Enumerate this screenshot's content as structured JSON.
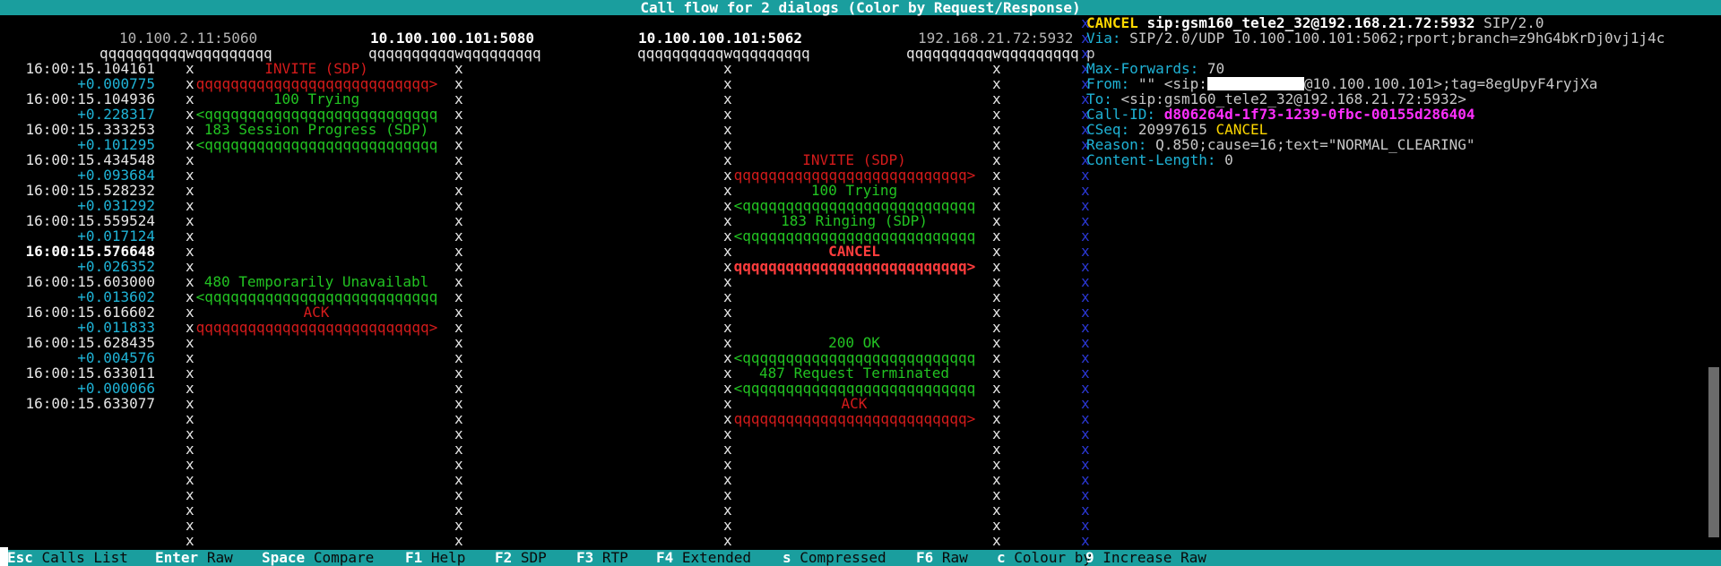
{
  "title": "Call flow for 2 dialogs (Color by Request/Response)",
  "hosts": [
    "10.100.2.11:5060",
    "10.100.100.101:5080",
    "10.100.100.101:5062",
    "192.168.21.72:5932"
  ],
  "host_underline": "qqqqqqqqqqwqqqqqqqqq",
  "lane_glyph": "x",
  "arrow_right": "qqqqqqqqqqqqqqqqqqqqqqqqqqq>",
  "arrow_left": "<qqqqqqqqqqqqqqqqqqqqqqqqqqq",
  "times": [
    {
      "time": "16:00:15.104161",
      "delta": "+0.000775"
    },
    {
      "time": "16:00:15.104936",
      "delta": "+0.228317"
    },
    {
      "time": "16:00:15.333253",
      "delta": "+0.101295"
    },
    {
      "time": "16:00:15.434548",
      "delta": "+0.093684"
    },
    {
      "time": "16:00:15.528232",
      "delta": "+0.031292"
    },
    {
      "time": "16:00:15.559524",
      "delta": "+0.017124"
    },
    {
      "time": "16:00:15.576648",
      "delta": "+0.026352"
    },
    {
      "time": "16:00:15.603000",
      "delta": "+0.013602"
    },
    {
      "time": "16:00:15.616602",
      "delta": "+0.011833"
    },
    {
      "time": "16:00:15.628435",
      "delta": "+0.004576"
    },
    {
      "time": "16:00:15.633011",
      "delta": "+0.000066"
    },
    {
      "time": "16:00:15.633077",
      "delta": ""
    }
  ],
  "messages": [
    {
      "label": "INVITE (SDP)",
      "dir": "right",
      "lane": 0,
      "row": 0,
      "color": "red"
    },
    {
      "label": "100 Trying",
      "dir": "left",
      "lane": 0,
      "row": 1,
      "color": "green"
    },
    {
      "label": "183 Session Progress (SDP)",
      "dir": "left",
      "lane": 0,
      "row": 2,
      "color": "green"
    },
    {
      "label": "INVITE (SDP)",
      "dir": "right",
      "lane": 2,
      "row": 3,
      "color": "red"
    },
    {
      "label": "100 Trying",
      "dir": "left",
      "lane": 2,
      "row": 4,
      "color": "green"
    },
    {
      "label": "183 Ringing (SDP)",
      "dir": "left",
      "lane": 2,
      "row": 5,
      "color": "green"
    },
    {
      "label": "CANCEL",
      "dir": "right",
      "lane": 2,
      "row": 6,
      "color": "red-bold"
    },
    {
      "label": "480 Temporarily Unavailabl",
      "dir": "left",
      "lane": 0,
      "row": 7,
      "color": "green"
    },
    {
      "label": "ACK",
      "dir": "right",
      "lane": 0,
      "row": 8,
      "color": "red"
    },
    {
      "label": "200 OK",
      "dir": "left",
      "lane": 2,
      "row": 9,
      "color": "green"
    },
    {
      "label": "487 Request Terminated",
      "dir": "left",
      "lane": 2,
      "row": 10,
      "color": "green"
    },
    {
      "label": "ACK",
      "dir": "right",
      "lane": 2,
      "row": 11,
      "color": "red"
    }
  ],
  "details": {
    "request_line": {
      "method": "CANCEL",
      "uri": "sip:gsm160_tele2_32@192.168.21.72:5932",
      "version": "SIP/2.0"
    },
    "via": {
      "key": "Via:",
      "value": "SIP/2.0/UDP 10.100.100.101:5062;rport;branch=z9hG4bKrDj0vj1j4c",
      "wrap": "p"
    },
    "max_forwards": {
      "key": "Max-Forwards:",
      "value": "70"
    },
    "from": {
      "key": "From:",
      "prefix": "\"\" <sip:",
      "suffix": "@10.100.100.101>;tag=8egUpyF4ryjXa"
    },
    "to": {
      "key": "To:",
      "value": "<sip:gsm160_tele2_32@192.168.21.72:5932>"
    },
    "call_id": {
      "key": "Call-ID:",
      "value": "d806264d-1f73-1239-0fbc-00155d286404"
    },
    "cseq": {
      "key": "CSeq:",
      "number": "20997615",
      "method": "CANCEL"
    },
    "reason": {
      "key": "Reason:",
      "value": "Q.850;cause=16;text=\"NORMAL_CLEARING\""
    },
    "content_length": {
      "key": "Content-Length:",
      "value": "0"
    }
  },
  "footer": [
    {
      "key": "Esc",
      "label": "Calls List"
    },
    {
      "key": "Enter",
      "label": "Raw"
    },
    {
      "key": "Space",
      "label": "Compare"
    },
    {
      "key": "F1",
      "label": "Help"
    },
    {
      "key": "F2",
      "label": "SDP"
    },
    {
      "key": "F3",
      "label": "RTP"
    },
    {
      "key": "F4",
      "label": "Extended"
    },
    {
      "key": "s",
      "label": "Compressed"
    },
    {
      "key": "F6",
      "label": "Raw"
    },
    {
      "key": "c",
      "label": "Colour by"
    },
    {
      "key": "9",
      "label": "Increase Raw"
    }
  ]
}
